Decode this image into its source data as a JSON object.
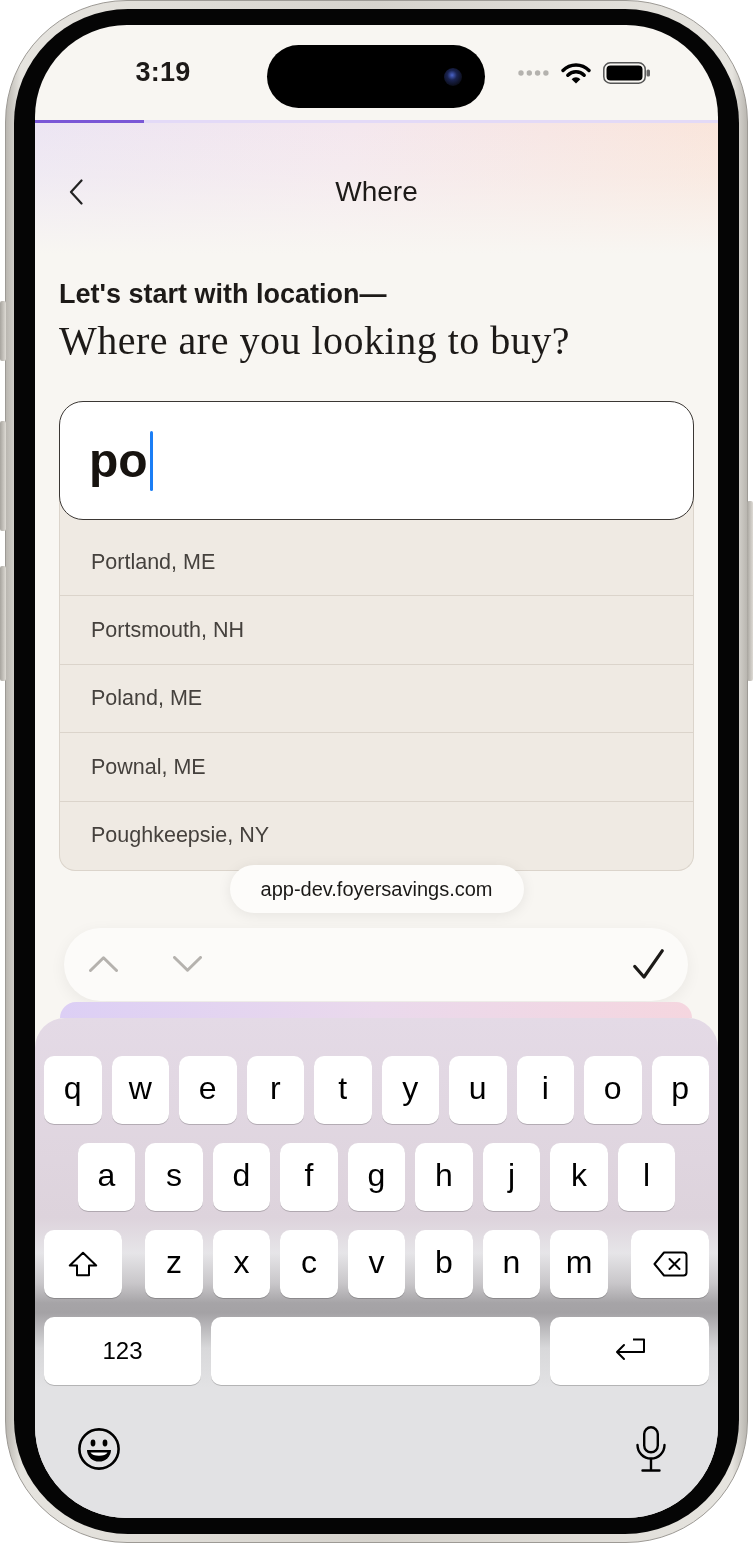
{
  "status_bar": {
    "time": "3:19"
  },
  "progress": {
    "level": 0.16
  },
  "header": {
    "title": "Where"
  },
  "prompt": {
    "eyebrow": "Let's start with location—",
    "question": "Where are you looking to buy?"
  },
  "location_field": {
    "value": "po"
  },
  "suggestions": [
    {
      "label": "Portland, ME"
    },
    {
      "label": "Portsmouth, NH"
    },
    {
      "label": "Poland, ME"
    },
    {
      "label": "Pownal, ME"
    },
    {
      "label": "Poughkeepsie, NY"
    }
  ],
  "address_bar": {
    "url": "app-dev.foyersavings.com"
  },
  "form_toolbar": {
    "buttons": [
      {
        "kind": "previous",
        "disabled": true
      },
      {
        "kind": "next",
        "disabled": true
      },
      {
        "kind": "done",
        "disabled": false
      }
    ]
  },
  "keyboard": {
    "rows": [
      [
        {
          "kind": "char",
          "label": "q"
        },
        {
          "kind": "char",
          "label": "w"
        },
        {
          "kind": "char",
          "label": "e"
        },
        {
          "kind": "char",
          "label": "r"
        },
        {
          "kind": "char",
          "label": "t"
        },
        {
          "kind": "char",
          "label": "y"
        },
        {
          "kind": "char",
          "label": "u"
        },
        {
          "kind": "char",
          "label": "i"
        },
        {
          "kind": "char",
          "label": "o"
        },
        {
          "kind": "char",
          "label": "p"
        }
      ],
      [
        {
          "kind": "char",
          "label": "a"
        },
        {
          "kind": "char",
          "label": "s"
        },
        {
          "kind": "char",
          "label": "d"
        },
        {
          "kind": "char",
          "label": "f"
        },
        {
          "kind": "char",
          "label": "g"
        },
        {
          "kind": "char",
          "label": "h"
        },
        {
          "kind": "char",
          "label": "j"
        },
        {
          "kind": "char",
          "label": "k"
        },
        {
          "kind": "char",
          "label": "l"
        }
      ],
      [
        {
          "kind": "shift",
          "on": false
        },
        {
          "kind": "char",
          "label": "z"
        },
        {
          "kind": "char",
          "label": "x"
        },
        {
          "kind": "char",
          "label": "c"
        },
        {
          "kind": "char",
          "label": "v"
        },
        {
          "kind": "char",
          "label": "b"
        },
        {
          "kind": "char",
          "label": "n"
        },
        {
          "kind": "char",
          "label": "m"
        },
        {
          "kind": "delete"
        }
      ],
      [
        {
          "kind": "mode",
          "label": "123"
        },
        {
          "kind": "space"
        },
        {
          "kind": "return"
        }
      ]
    ],
    "bottom": [
      {
        "kind": "emoji"
      },
      {
        "kind": "dictation"
      }
    ]
  }
}
